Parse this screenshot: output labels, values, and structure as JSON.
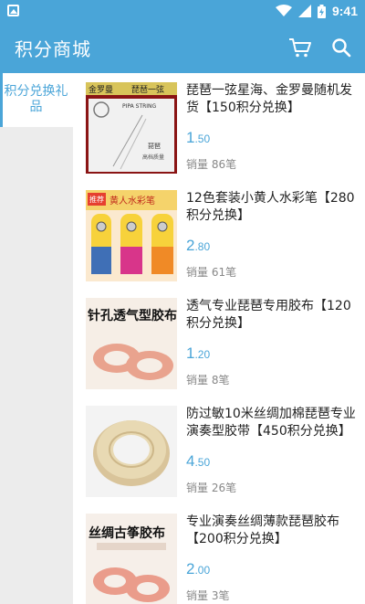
{
  "status_bar": {
    "time": "9:41"
  },
  "header": {
    "title": "积分商城"
  },
  "sidebar": {
    "categories": [
      {
        "label": "积分兑换礼品"
      }
    ]
  },
  "products": [
    {
      "name": "琵琶一弦星海、金罗曼随机发货【150积分兑换】",
      "price_int": "1",
      "price_dec": ".50",
      "sales": "销量 86笔",
      "image_text": [
        "金罗曼",
        "琵琶一弦",
        "PIPA STRING",
        "琵琶",
        "高档质量"
      ]
    },
    {
      "name": "12色套装小黄人水彩笔【280积分兑换】",
      "price_int": "2",
      "price_dec": ".80",
      "sales": "销量 61笔",
      "image_text": [
        "推荐",
        "黄人水彩笔"
      ]
    },
    {
      "name": "透气专业琵琶专用胶布【120积分兑换】",
      "price_int": "1",
      "price_dec": ".20",
      "sales": "销量 8笔",
      "image_text": [
        "针孔透气型胶布"
      ]
    },
    {
      "name": "防过敏10米丝绸加棉琵琶专业演奏型胶带【450积分兑换】",
      "price_int": "4",
      "price_dec": ".50",
      "sales": "销量 26笔",
      "image_text": []
    },
    {
      "name": "专业演奏丝绸薄款琵琶胶布【200积分兑换】",
      "price_int": "2",
      "price_dec": ".00",
      "sales": "销量 3笔",
      "image_text": [
        "丝绸古筝胶布"
      ]
    }
  ],
  "colors": {
    "accent": "#4aa5d8",
    "sidebar_bg": "#ececec",
    "muted": "#888888"
  },
  "icons": [
    "image-icon",
    "wifi-icon",
    "signal-icon",
    "battery-icon",
    "cart-icon",
    "search-icon"
  ]
}
